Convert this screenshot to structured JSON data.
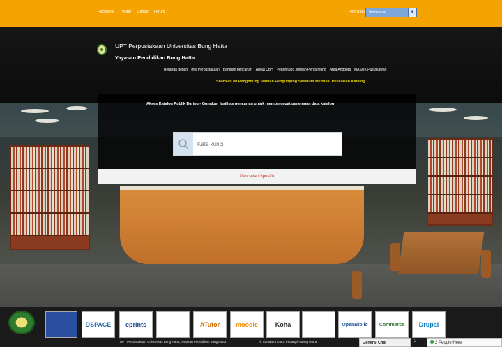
{
  "topbar": {
    "links": [
      "Facebook",
      "Twitter",
      "Github",
      "Forum"
    ],
    "language_label": "Pilih Bahasa",
    "language_value": "Indonesia"
  },
  "header": {
    "institution_line1": "UPT Perpustakaan Universitas Bung Hatta",
    "institution_line2": "Yayasan Pendidikan Bung Hatta",
    "nav": [
      "Beranda depan",
      "Info Perpustakaan",
      "Bantuan pencarian",
      "About UBH",
      "Penghitung Jumlah Pengunjung",
      "Area Anggota",
      "MASUK Pustakawan"
    ],
    "notice": "Silahkan Isi Penghitung Jumlah Pengunjung Sebelum Memulai Pencarian Katalog"
  },
  "search": {
    "intro": "Akses Katalog Publik Daring - Gunakan fasilitas pencarian untuk mempercepat penemuan data katalog",
    "placeholder": "Kata kunci",
    "specific_label": "Pencarian Spesifik"
  },
  "footer": {
    "badges": [
      "",
      "DSPACE",
      "eprints",
      "",
      "ATutor",
      "moodle",
      "Koha",
      "",
      "OpenBiblio",
      "Commerce",
      "Drupal"
    ],
    "copyright": "UPT Perpustakaan Universitas Bung Hatta, Yayasan Pendidikan Bung Hatta",
    "location": "© Sumatera Utara Padang/Padang Utara",
    "chat_title": "General Chat",
    "chat_count": "2",
    "chat_people": "2 People Here"
  },
  "colors": {
    "topbar": "#f5a300",
    "notice": "#e8d200",
    "specific_link": "#cc2a2a"
  }
}
